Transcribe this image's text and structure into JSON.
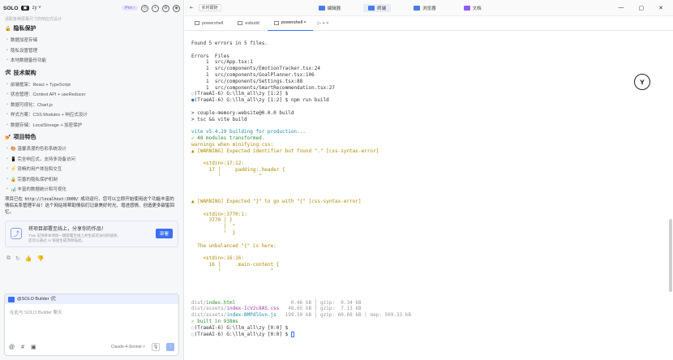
{
  "topbar_left": {
    "logo": "SOLO",
    "logo_badge": "▣",
    "project": "zy ˅",
    "pro": "Pro ›"
  },
  "left": {
    "faded_top": "适配各种屏幕尺寸的响应式设计",
    "sections": [
      {
        "emoji": "🔒",
        "title": "隐私保护",
        "items": [
          "数据加密存储",
          "隐私设置管理",
          "本地数据备份功能"
        ]
      },
      {
        "emoji": "🛠",
        "title": "技术架构",
        "items": [
          "前端框架：React + TypeScript",
          "状态管理：Context API + useReducer",
          "数据可视化：Chart.js",
          "样式方案：CSS Modules + 响应式设计",
          "数据存储：LocalStorage + 加密保护"
        ]
      },
      {
        "emoji": "💅",
        "title": "项目特色",
        "items": [
          "🎨 温馨浪漫的色彩系统设计",
          "📱 完全响应式，支持多设备访问",
          "⚡ 流畅的用户体验和交互",
          "🔒 完善的隐私保护机制",
          "📊 丰富的数据统计和可视化"
        ]
      }
    ],
    "para_a": "项目已在 ",
    "para_url": "http://localhost:3000/",
    "para_b": " 成功运行，您可以立即开始使用这个功能丰富的情侣关系管理平台！这个网站将帮助情侣们记录美好时光、增进感情、创造更多甜蜜回忆。",
    "card_title": "将项目部署至线上，分享你的作品！",
    "card_sub1": "Trae 支持将本项目一键部署至线上并生成可访问的链接，",
    "card_sub2": "还可以通过 AI 快速生成项目描述。",
    "card_btn": "部署",
    "actions": [
      "⧉",
      "↻",
      "👍",
      "👎"
    ]
  },
  "input": {
    "header": "@SOLO Builder 🛠",
    "placeholder": "在此与 SOLO Builder 聊天",
    "bottom_icons": [
      "@",
      "#",
      "▣"
    ],
    "model": "Claude-4-Sonnet ˅"
  },
  "right_top": {
    "collapse": "⇤",
    "realtime": "实时跟随",
    "tabs": [
      "编辑器",
      "终端",
      "浏览器",
      "文档"
    ],
    "active_tab": 1
  },
  "term_tabs": [
    "powershell",
    "esbuild",
    "powershell ×"
  ],
  "term_add": "▷  + ˅",
  "terminal": [
    {
      "t": "Found 5 errors in 5 files.",
      "c": ""
    },
    {
      "t": "",
      "c": ""
    },
    {
      "t": "Errors  Files",
      "c": ""
    },
    {
      "t": "     1  src/App.tsx:1",
      "c": ""
    },
    {
      "t": "     1  src/components/EmotionTracker.tsx:24",
      "c": ""
    },
    {
      "t": "     1  src/components/GoalPlanner.tsx:106",
      "c": ""
    },
    {
      "t": "     1  src/components/Settings.tsx:88",
      "c": ""
    },
    {
      "t": "     1  src/components/SmartRecommendation.tsx:27",
      "c": ""
    },
    {
      "t": "(TraeAI-6) G:\\llm_all\\zy [1:2] $",
      "c": "",
      "m": "○",
      "mc": "gray"
    },
    {
      "t": "(TraeAI-6) G:\\llm_all\\zy [1:2] $ npm run build",
      "c": "",
      "m": "●",
      "mc": "blue"
    },
    {
      "t": "",
      "c": ""
    },
    {
      "t": "> couple-memory-website@0.0.0 build",
      "c": ""
    },
    {
      "t": "> tsc && vite build",
      "c": ""
    },
    {
      "t": "",
      "c": ""
    },
    {
      "t": "vite v5.4.19 building for production...",
      "c": "cyan"
    },
    {
      "t": "✓ 48 modules transformed.",
      "c": "green"
    },
    {
      "t": "warnings when minifying css:",
      "c": "warn"
    },
    {
      "t": "▲ [WARNING] Expected identifier but found \".\" [css-syntax-error]",
      "c": "warn"
    },
    {
      "t": "",
      "c": ""
    },
    {
      "t": "    <stdin>:17:12:",
      "c": "warn"
    },
    {
      "t": "      17 │     padding:.header {",
      "c": "warn"
    },
    {
      "t": "         ╵             ^",
      "c": "warn"
    },
    {
      "t": "",
      "c": ""
    },
    {
      "t": "",
      "c": ""
    },
    {
      "t": "",
      "c": ""
    },
    {
      "t": "▲ [WARNING] Expected \"}\" to go with \"{\" [css-syntax-error]",
      "c": "warn"
    },
    {
      "t": "",
      "c": ""
    },
    {
      "t": "    <stdin>:3770:1:",
      "c": "warn"
    },
    {
      "t": "      3770 │ }",
      "c": "warn"
    },
    {
      "t": "           │  ^",
      "c": "warn"
    },
    {
      "t": "           ╵  }",
      "c": "warn"
    },
    {
      "t": "",
      "c": ""
    },
    {
      "t": "  The unbalanced \"{\" is here:",
      "c": "warn"
    },
    {
      "t": "",
      "c": ""
    },
    {
      "t": "    <stdin>:16:16:",
      "c": "warn"
    },
    {
      "t": "      16 │     .main-content {",
      "c": "warn"
    },
    {
      "t": "         ╵                 ^",
      "c": "warn"
    },
    {
      "t": "",
      "c": ""
    },
    {
      "t": "",
      "c": ""
    },
    {
      "t": "",
      "c": ""
    },
    {
      "t": "",
      "c": ""
    },
    {
      "t": "dist/index.html                   0.46 kB │ gzip:  0.34 kB",
      "c": "dist"
    },
    {
      "t": "dist/assets/index-IcV2c8AS.css   48.65 kB │ gzip:  7.13 kB",
      "c": "dist"
    },
    {
      "t": "dist/assets/index-BMPdlGvn.js   199.59 kB │ gzip: 60.68 kB │ map: 509.33 kB",
      "c": "dist"
    },
    {
      "t": "✓ built in 938ms",
      "c": "green"
    },
    {
      "t": "(TraeAI-6) G:\\llm_all\\zy [0:0] $",
      "c": "",
      "m": "○",
      "mc": "gray"
    },
    {
      "t": "(TraeAI-6) G:\\llm_all\\zy [0:0] $ ",
      "c": "",
      "m": "○",
      "mc": "gray",
      "cursor": true
    }
  ],
  "window": {
    "min": "—",
    "max": "▢",
    "close": "✕"
  }
}
